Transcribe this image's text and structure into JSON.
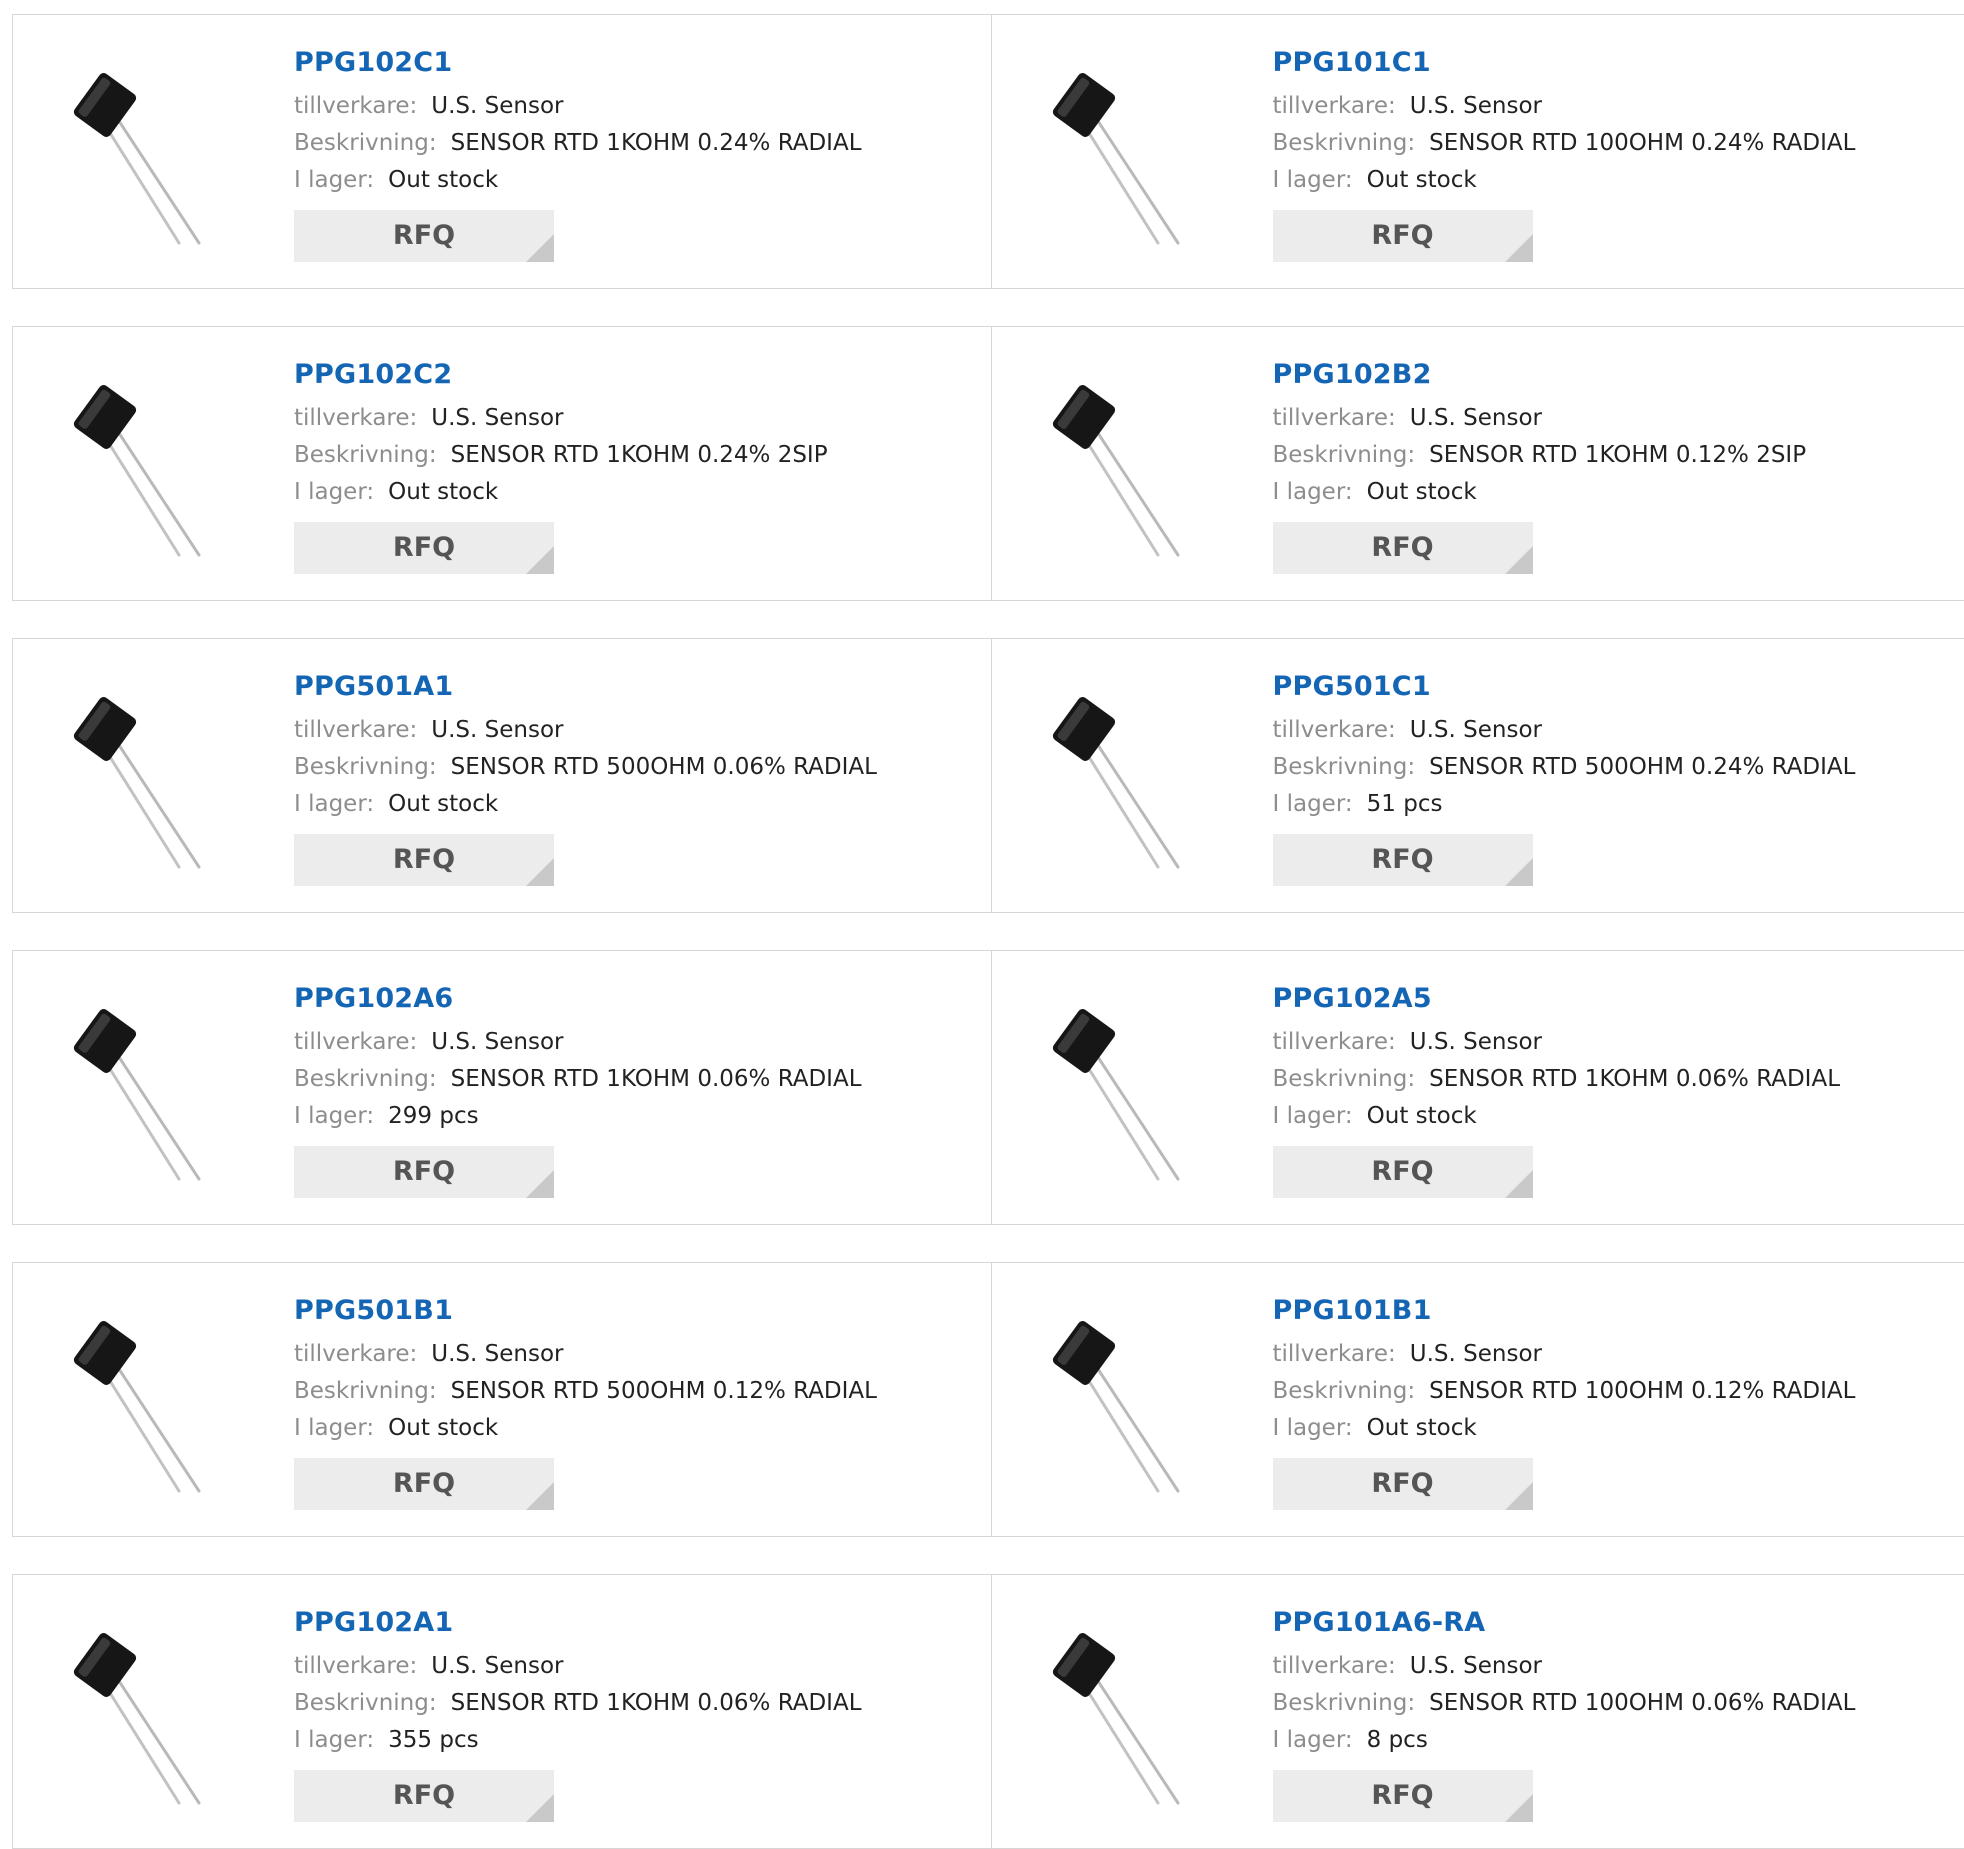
{
  "labels": {
    "manufacturer": "tillverkare:",
    "description": "Beskrivning:",
    "stock": "I lager:",
    "rfq": "RFQ"
  },
  "products": [
    {
      "pn": "PPG102C1",
      "manufacturer": "U.S. Sensor",
      "description": "SENSOR RTD 1KOHM 0.24% RADIAL",
      "stock": "Out stock"
    },
    {
      "pn": "PPG101C1",
      "manufacturer": "U.S. Sensor",
      "description": "SENSOR RTD 100OHM 0.24% RADIAL",
      "stock": "Out stock"
    },
    {
      "pn": "PPG102C2",
      "manufacturer": "U.S. Sensor",
      "description": "SENSOR RTD 1KOHM 0.24% 2SIP",
      "stock": "Out stock"
    },
    {
      "pn": "PPG102B2",
      "manufacturer": "U.S. Sensor",
      "description": "SENSOR RTD 1KOHM 0.12% 2SIP",
      "stock": "Out stock"
    },
    {
      "pn": "PPG501A1",
      "manufacturer": "U.S. Sensor",
      "description": "SENSOR RTD 500OHM 0.06% RADIAL",
      "stock": "Out stock"
    },
    {
      "pn": "PPG501C1",
      "manufacturer": "U.S. Sensor",
      "description": "SENSOR RTD 500OHM 0.24% RADIAL",
      "stock": "51 pcs"
    },
    {
      "pn": "PPG102A6",
      "manufacturer": "U.S. Sensor",
      "description": "SENSOR RTD 1KOHM 0.06% RADIAL",
      "stock": "299 pcs"
    },
    {
      "pn": "PPG102A5",
      "manufacturer": "U.S. Sensor",
      "description": "SENSOR RTD 1KOHM 0.06% RADIAL",
      "stock": "Out stock"
    },
    {
      "pn": "PPG501B1",
      "manufacturer": "U.S. Sensor",
      "description": "SENSOR RTD 500OHM 0.12% RADIAL",
      "stock": "Out stock"
    },
    {
      "pn": "PPG101B1",
      "manufacturer": "U.S. Sensor",
      "description": "SENSOR RTD 100OHM 0.12% RADIAL",
      "stock": "Out stock"
    },
    {
      "pn": "PPG102A1",
      "manufacturer": "U.S. Sensor",
      "description": "SENSOR RTD 1KOHM 0.06% RADIAL",
      "stock": "355 pcs"
    },
    {
      "pn": "PPG101A6-RA",
      "manufacturer": "U.S. Sensor",
      "description": "SENSOR RTD 100OHM 0.06% RADIAL",
      "stock": "8 pcs"
    }
  ],
  "colors": {
    "link": "#1565b5",
    "label": "#8d8d8d",
    "value": "#222222",
    "button_bg": "#ececec",
    "button_text": "#555555",
    "border": "#d6d6d6"
  },
  "icons": {
    "thumbnail": "rtd-sensor-image",
    "button_corner": "triangle-corner-icon"
  }
}
